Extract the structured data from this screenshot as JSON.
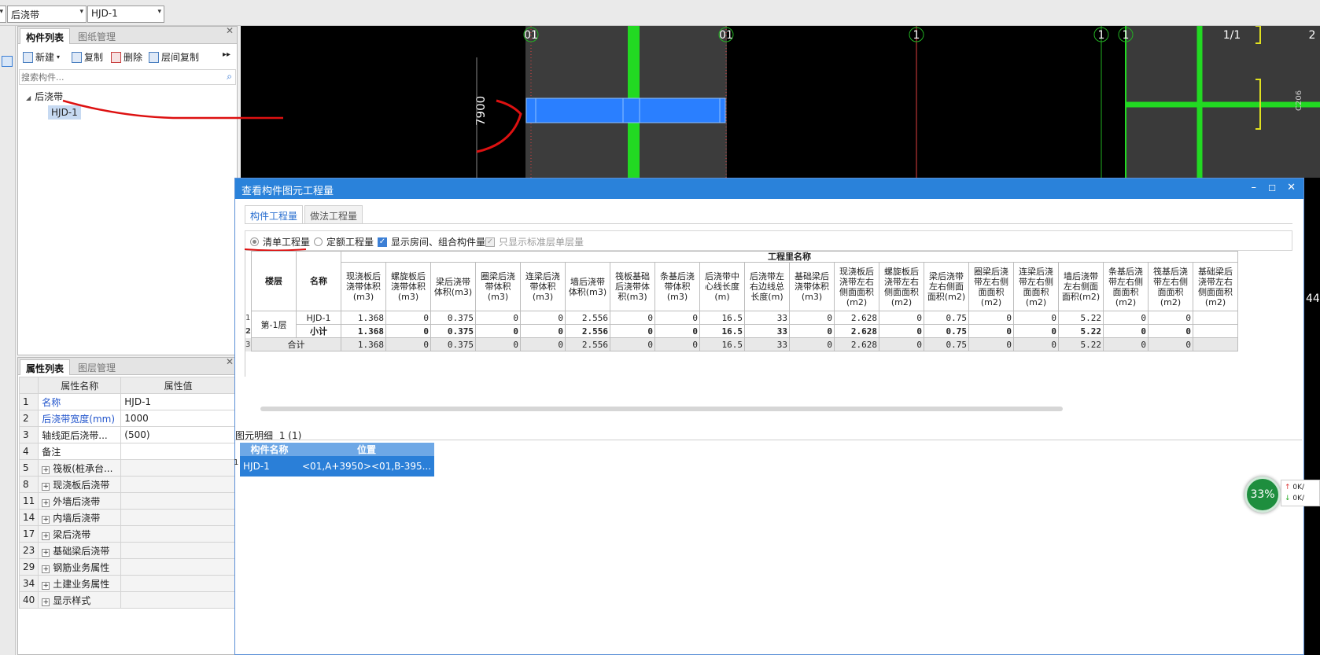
{
  "topbar": {
    "combo1": "后浇带",
    "combo2": "HJD-1"
  },
  "component_panel": {
    "tabs": [
      "构件列表",
      "图纸管理"
    ],
    "toolbar": {
      "new": "新建",
      "copy": "复制",
      "delete": "删除",
      "floor_copy": "层间复制"
    },
    "search_placeholder": "搜索构件...",
    "tree": {
      "root": "后浇带",
      "child": "HJD-1"
    }
  },
  "property_panel": {
    "tabs": [
      "属性列表",
      "图层管理"
    ],
    "headers": {
      "name": "属性名称",
      "value": "属性值"
    },
    "rows": [
      {
        "no": "1",
        "name": "名称",
        "value": "HJD-1",
        "blue": true,
        "plus": false
      },
      {
        "no": "2",
        "name": "后浇带宽度(mm)",
        "value": "1000",
        "blue": true,
        "plus": false
      },
      {
        "no": "3",
        "name": "轴线距后浇带...",
        "value": "(500)",
        "blue": false,
        "plus": false
      },
      {
        "no": "4",
        "name": "备注",
        "value": "",
        "blue": false,
        "plus": false
      },
      {
        "no": "5",
        "name": "筏板(桩承台...",
        "value": "",
        "blue": false,
        "plus": true
      },
      {
        "no": "8",
        "name": "现浇板后浇带",
        "value": "",
        "blue": false,
        "plus": true
      },
      {
        "no": "11",
        "name": "外墙后浇带",
        "value": "",
        "blue": false,
        "plus": true
      },
      {
        "no": "14",
        "name": "内墙后浇带",
        "value": "",
        "blue": false,
        "plus": true
      },
      {
        "no": "17",
        "name": "梁后浇带",
        "value": "",
        "blue": false,
        "plus": true
      },
      {
        "no": "23",
        "name": "基础梁后浇带",
        "value": "",
        "blue": false,
        "plus": true
      },
      {
        "no": "29",
        "name": "钢筋业务属性",
        "value": "",
        "blue": false,
        "plus": true
      },
      {
        "no": "34",
        "name": "土建业务属性",
        "value": "",
        "blue": false,
        "plus": true
      },
      {
        "no": "40",
        "name": "显示样式",
        "value": "",
        "blue": false,
        "plus": true
      }
    ]
  },
  "cad": {
    "axis_labels": [
      "01",
      "01",
      "1",
      "1",
      "1/1",
      "2"
    ],
    "dimension": "7900",
    "right_label": "C206",
    "edge_digits": "44"
  },
  "dialog": {
    "title": "查看构件图元工程量",
    "tabs": [
      "构件工程量",
      "做法工程量"
    ],
    "options": {
      "list_qty": "清单工程量",
      "quota_qty": "定额工程量",
      "show_rooms": "显示房间、组合构件量",
      "std_floor_only": "只显示标准层单层量"
    },
    "table": {
      "group_header": "工程里名称",
      "col_floor": "楼层",
      "col_name": "名称",
      "columns": [
        "现浇板后浇带体积(m3)",
        "螺旋板后浇带体积(m3)",
        "梁后浇带体积(m3)",
        "圈梁后浇带体积(m3)",
        "连梁后浇带体积(m3)",
        "墙后浇带体积(m3)",
        "筏板基础后浇带体积(m3)",
        "条基后浇带体积(m3)",
        "后浇带中心线长度(m)",
        "后浇带左右边线总长度(m)",
        "基础梁后浇带体积(m3)",
        "现浇板后浇带左右侧面面积(m2)",
        "螺旋板后浇带左右侧面面积(m2)",
        "梁后浇带左右侧面面积(m2)",
        "圈梁后浇带左右侧面面积(m2)",
        "连梁后浇带左右侧面面积(m2)",
        "墙后浇带左右侧面面积(m2)",
        "条基后浇带左右侧面面积(m2)",
        "筏基后浇带左右侧面面积(m2)",
        "基础梁后浇带左右侧面面积(m2)"
      ],
      "rows": [
        {
          "idx": "1",
          "floor": "第-1层",
          "name": "HJD-1",
          "values": [
            "1.368",
            "0",
            "0.375",
            "0",
            "0",
            "2.556",
            "0",
            "0",
            "16.5",
            "33",
            "0",
            "2.628",
            "0",
            "0.75",
            "0",
            "0",
            "5.22",
            "0",
            "0",
            ""
          ]
        },
        {
          "idx": "2",
          "floor": "",
          "name": "小计",
          "values": [
            "1.368",
            "0",
            "0.375",
            "0",
            "0",
            "2.556",
            "0",
            "0",
            "16.5",
            "33",
            "0",
            "2.628",
            "0",
            "0.75",
            "0",
            "0",
            "5.22",
            "0",
            "0",
            ""
          ]
        },
        {
          "idx": "3",
          "floor": "合计",
          "name": "",
          "values": [
            "1.368",
            "0",
            "0.375",
            "0",
            "0",
            "2.556",
            "0",
            "0",
            "16.5",
            "33",
            "0",
            "2.628",
            "0",
            "0.75",
            "0",
            "0",
            "5.22",
            "0",
            "0",
            ""
          ]
        }
      ]
    },
    "detail": {
      "label": "图元明细",
      "count": "1 (1)",
      "headers": [
        "构件名称",
        "位置"
      ],
      "rows": [
        {
          "idx": "1",
          "name": "HJD-1",
          "position": "<01,A+3950><01,B-395..."
        }
      ]
    }
  },
  "badge": {
    "percent": "33%",
    "up": "0K/",
    "down": "0K/"
  }
}
